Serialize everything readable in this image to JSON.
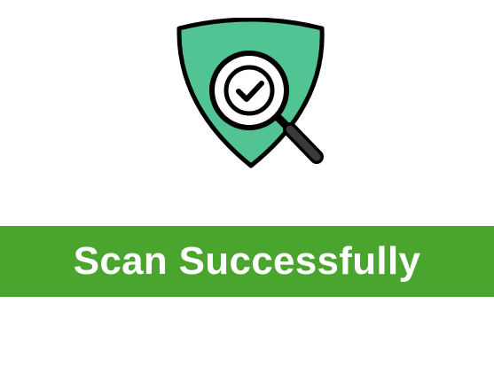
{
  "colors": {
    "banner_background": "#4aa52f",
    "banner_text": "#ffffff",
    "shield_fill": "#52c493",
    "outline": "#000000",
    "lens_fill": "#ffffff",
    "handle_fill": "#333333"
  },
  "illustration": {
    "shield_icon": "shield-icon",
    "magnifier_icon": "magnifying-glass-icon",
    "check_icon": "checkmark-icon"
  },
  "banner": {
    "text": "Scan Successfully"
  }
}
